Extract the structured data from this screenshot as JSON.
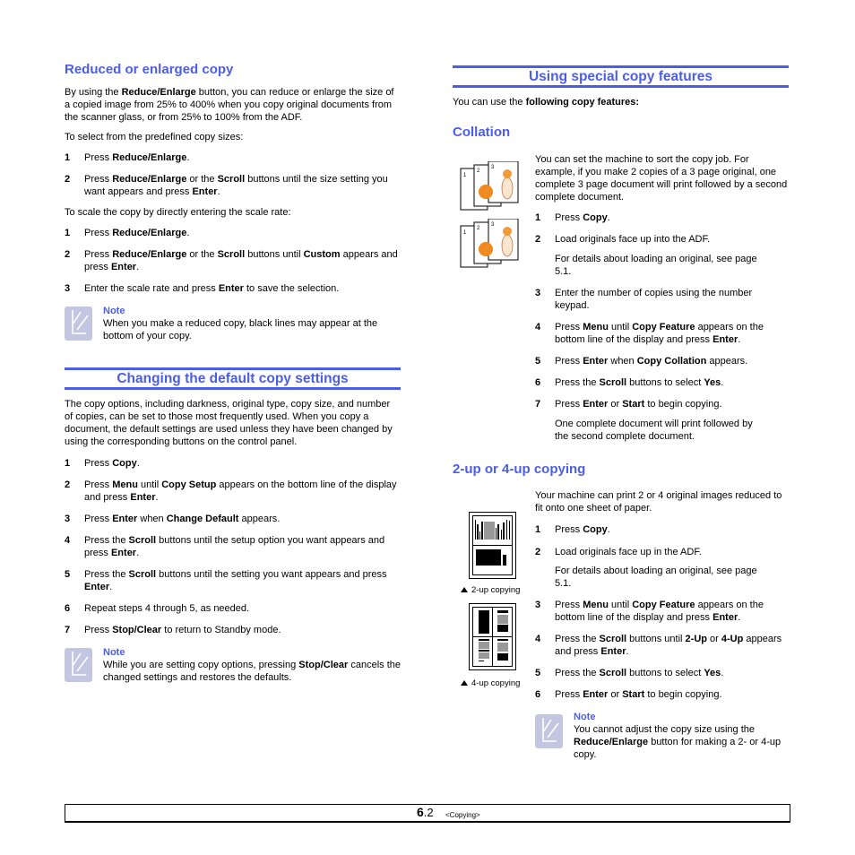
{
  "left": {
    "reduced": {
      "title": "Reduced or enlarged copy",
      "intro": [
        {
          "t": "By using the "
        },
        {
          "b": "Reduce/Enlarge"
        },
        {
          "t": " button, you can reduce or enlarge the size of a copied image from 25% to 400% when you copy original documents from the scanner glass, or from 25% to 100% from the ADF."
        }
      ],
      "predefined_label": "To select from the predefined copy sizes:",
      "predefined_steps": [
        {
          "num": "1",
          "parts": [
            {
              "t": "Press "
            },
            {
              "b": "Reduce/Enlarge"
            },
            {
              "t": "."
            }
          ]
        },
        {
          "num": "2",
          "parts": [
            {
              "t": "Press "
            },
            {
              "b": "Reduce/Enlarge"
            },
            {
              "t": " or the "
            },
            {
              "b": "Scroll"
            },
            {
              "t": " buttons until the size setting you want appears and press "
            },
            {
              "b": "Enter"
            },
            {
              "t": "."
            }
          ]
        }
      ],
      "scale_label": "To scale the copy by directly entering the scale rate:",
      "scale_steps": [
        {
          "num": "1",
          "parts": [
            {
              "t": "Press "
            },
            {
              "b": "Reduce/Enlarge"
            },
            {
              "t": "."
            }
          ]
        },
        {
          "num": "2",
          "parts": [
            {
              "t": "Press "
            },
            {
              "b": "Reduce/Enlarge"
            },
            {
              "t": " or the "
            },
            {
              "b": "Scroll"
            },
            {
              "t": " buttons until "
            },
            {
              "b": "Custom"
            },
            {
              "t": " appears and press "
            },
            {
              "b": "Enter"
            },
            {
              "t": "."
            }
          ]
        },
        {
          "num": "3",
          "parts": [
            {
              "t": "Enter the scale rate and press "
            },
            {
              "b": "Enter"
            },
            {
              "t": " to save the selection."
            }
          ]
        }
      ],
      "note": {
        "title": "Note",
        "parts": [
          {
            "t": "When you make a reduced copy, black lines may appear at the bottom of your copy."
          }
        ]
      }
    },
    "defaults": {
      "title": "Changing the default copy settings",
      "intro": "The copy options, including darkness, original type, copy size, and number of copies, can be set to those most frequently used. When you copy a document, the default settings are used unless they have been changed by using the corresponding buttons on the control panel.",
      "steps": [
        {
          "num": "1",
          "parts": [
            {
              "t": "Press "
            },
            {
              "b": "Copy"
            },
            {
              "t": "."
            }
          ]
        },
        {
          "num": "2",
          "parts": [
            {
              "t": "Press "
            },
            {
              "b": "Menu"
            },
            {
              "t": " until "
            },
            {
              "b": "Copy Setup"
            },
            {
              "t": " appears on the bottom line of the display and press "
            },
            {
              "b": "Enter"
            },
            {
              "t": "."
            }
          ]
        },
        {
          "num": "3",
          "parts": [
            {
              "t": "Press "
            },
            {
              "b": "Enter"
            },
            {
              "t": " when "
            },
            {
              "b": "Change Default"
            },
            {
              "t": " appears."
            }
          ]
        },
        {
          "num": "4",
          "parts": [
            {
              "t": "Press the "
            },
            {
              "b": "Scroll"
            },
            {
              "t": " buttons until the setup option you want appears and press "
            },
            {
              "b": "Enter"
            },
            {
              "t": "."
            }
          ]
        },
        {
          "num": "5",
          "parts": [
            {
              "t": "Press the "
            },
            {
              "b": "Scroll"
            },
            {
              "t": " buttons until the setting you want appears and press "
            },
            {
              "b": "Enter"
            },
            {
              "t": "."
            }
          ]
        },
        {
          "num": "6",
          "parts": [
            {
              "t": "Repeat steps 4 through 5, as needed."
            }
          ]
        },
        {
          "num": "7",
          "parts": [
            {
              "t": "Press "
            },
            {
              "b": "Stop/Clear"
            },
            {
              "t": " to return to Standby mode."
            }
          ]
        }
      ],
      "note": {
        "title": "Note",
        "parts": [
          {
            "t": "While you are setting copy options, pressing "
          },
          {
            "b": "Stop/Clear"
          },
          {
            "t": " cancels the changed settings and restores the defaults."
          }
        ]
      }
    }
  },
  "right": {
    "special": {
      "title": "Using special copy features",
      "intro": [
        {
          "t": "You can use the "
        },
        {
          "b": "following copy features:"
        }
      ]
    },
    "collation": {
      "title": "Collation",
      "intro": "You can set the machine to sort the copy job. For example, if you make 2 copies of a 3 page original, one complete 3 page document will print followed by a second complete document.",
      "page_numbers": [
        "1",
        "2",
        "3"
      ],
      "steps": [
        {
          "num": "1",
          "parts": [
            {
              "t": "Press "
            },
            {
              "b": "Copy"
            },
            {
              "t": "."
            }
          ]
        },
        {
          "num": "2",
          "parts": [
            {
              "t": "Load originals face up into the ADF."
            }
          ],
          "sub": "For details about loading an original, see page 5.1."
        },
        {
          "num": "3",
          "parts": [
            {
              "t": "Enter the number of copies using the number keypad."
            }
          ]
        },
        {
          "num": "4",
          "parts": [
            {
              "t": "Press "
            },
            {
              "b": "Menu"
            },
            {
              "t": " until "
            },
            {
              "b": "Copy Feature"
            },
            {
              "t": " appears on the bottom line of the display and press "
            },
            {
              "b": "Enter"
            },
            {
              "t": "."
            }
          ]
        },
        {
          "num": "5",
          "parts": [
            {
              "t": "Press "
            },
            {
              "b": "Enter"
            },
            {
              "t": " when "
            },
            {
              "b": "Copy Collation"
            },
            {
              "t": " appears."
            }
          ]
        },
        {
          "num": "6",
          "parts": [
            {
              "t": "Press the "
            },
            {
              "b": "Scroll"
            },
            {
              "t": " buttons to select "
            },
            {
              "b": "Yes"
            },
            {
              "t": "."
            }
          ]
        },
        {
          "num": "7",
          "parts": [
            {
              "t": "Press "
            },
            {
              "b": "Enter"
            },
            {
              "t": " or "
            },
            {
              "b": "Start"
            },
            {
              "t": " to begin copying."
            }
          ],
          "sub": "One complete document will print followed by the second complete document."
        }
      ]
    },
    "nup": {
      "title": "2-up or 4-up copying",
      "intro": "Your machine can print 2 or 4 original images reduced to fit onto one sheet of paper.",
      "caption_2up": "2-up copying",
      "caption_4up": "4-up copying",
      "steps": [
        {
          "num": "1",
          "parts": [
            {
              "t": "Press "
            },
            {
              "b": "Copy"
            },
            {
              "t": "."
            }
          ]
        },
        {
          "num": "2",
          "parts": [
            {
              "t": "Load originals face up in the ADF."
            }
          ],
          "sub": "For details about loading an original, see page 5.1."
        },
        {
          "num": "3",
          "parts": [
            {
              "t": "Press "
            },
            {
              "b": "Menu"
            },
            {
              "t": " until "
            },
            {
              "b": "Copy Feature"
            },
            {
              "t": " appears on the bottom line of the display and press "
            },
            {
              "b": "Enter"
            },
            {
              "t": "."
            }
          ]
        },
        {
          "num": "4",
          "parts": [
            {
              "t": "Press the "
            },
            {
              "b": "Scroll"
            },
            {
              "t": " buttons until "
            },
            {
              "b": "2-Up"
            },
            {
              "t": " or "
            },
            {
              "b": "4-Up"
            },
            {
              "t": " appears and press "
            },
            {
              "b": "Enter"
            },
            {
              "t": "."
            }
          ]
        },
        {
          "num": "5",
          "parts": [
            {
              "t": "Press the "
            },
            {
              "b": "Scroll"
            },
            {
              "t": " buttons to select "
            },
            {
              "b": "Yes"
            },
            {
              "t": "."
            }
          ]
        },
        {
          "num": "6",
          "parts": [
            {
              "t": "Press "
            },
            {
              "b": "Enter"
            },
            {
              "t": " or "
            },
            {
              "b": "Start"
            },
            {
              "t": " to begin copying."
            }
          ]
        }
      ],
      "note": {
        "title": "Note",
        "parts": [
          {
            "t": "You cannot adjust the copy size using the "
          },
          {
            "b": "Reduce/Enlarge"
          },
          {
            "t": " button for making a 2- or 4-up copy."
          }
        ]
      }
    }
  },
  "footer": {
    "page_major": "6",
    "page_minor": ".2",
    "chapter": "<Copying>"
  },
  "colors": {
    "heading": "#4c5ee8",
    "note_icon": "#c3c6e0"
  }
}
